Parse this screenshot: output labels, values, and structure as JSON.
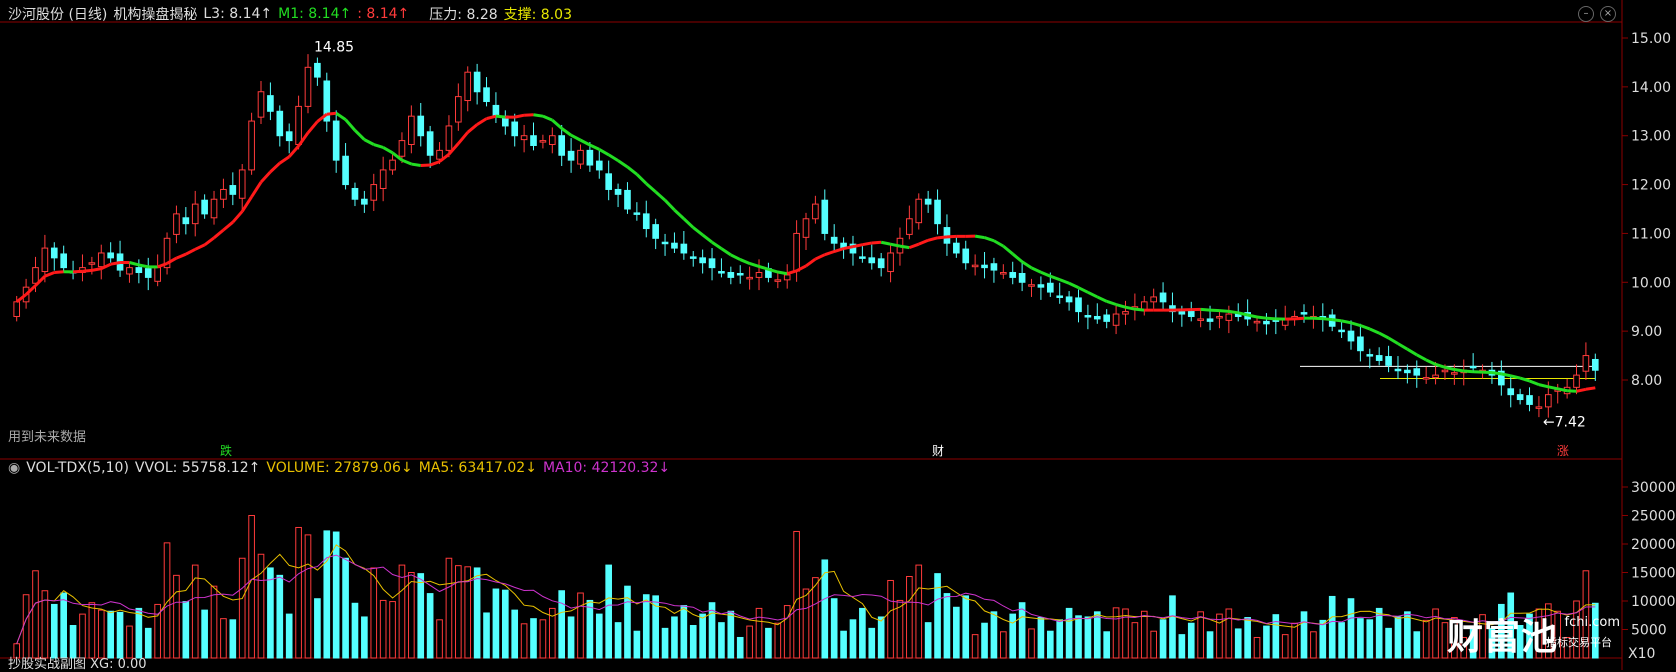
{
  "header": {
    "stock": "沙河股份 (日线)",
    "indicator": "机构操盘揭秘",
    "l3": "L3: 8.14↑",
    "m1": "M1: 8.14↑",
    "m2": ": 8.14↑",
    "pressure": "压力: 8.28",
    "support": "支撑: 8.03"
  },
  "vol_header": {
    "name": "VOL-TDX(5,10)",
    "vvol": "VVOL: 55758.12↑",
    "volume": "VOLUME: 27879.06↓",
    "ma5": "MA5: 63417.02↓",
    "ma10": "MA10: 42120.32↓"
  },
  "bottom_label": "抄股实战副图 XG: 0.00",
  "notes": {
    "future_data": "用到未来数据",
    "high_label": "14.85",
    "low_label": "←7.42",
    "die": "跌",
    "cai": "财",
    "zhang": "涨"
  },
  "watermark": {
    "logo": "财富池",
    "site": "fchi.com",
    "tag": "指标交易平台"
  },
  "colors": {
    "up": "#ff3b3b",
    "down": "#55ffff",
    "ma_red": "#ff1a1a",
    "ma_green": "#22dd22",
    "ma5": "#e8c000",
    "ma10": "#cc33cc",
    "support_line": "#e8e800",
    "pressure_line": "#ffffff",
    "grid": "#8b0000"
  },
  "chart_data": {
    "type": "candlestick",
    "price_axis": {
      "ticks": [
        8.0,
        9.0,
        10.0,
        11.0,
        12.0,
        13.0,
        14.0,
        15.0
      ],
      "ylim": [
        7.2,
        15.3
      ]
    },
    "volume_axis": {
      "ticks": [
        5000,
        10000,
        15000,
        20000,
        25000,
        30000
      ],
      "ylim": [
        0,
        32000
      ],
      "unit": "X10"
    },
    "close": [
      9.6,
      9.9,
      10.3,
      10.7,
      10.5,
      10.3,
      10.2,
      10.3,
      10.4,
      10.6,
      10.5,
      10.25,
      10.3,
      10.2,
      10.1,
      10.3,
      10.9,
      11.4,
      11.2,
      11.6,
      11.4,
      11.7,
      11.9,
      11.8,
      12.3,
      13.3,
      13.9,
      13.5,
      13.0,
      12.9,
      13.6,
      14.4,
      14.2,
      13.3,
      12.5,
      12.0,
      11.7,
      11.6,
      12.0,
      12.3,
      12.5,
      12.9,
      13.4,
      13.0,
      12.6,
      12.7,
      13.2,
      13.8,
      14.3,
      13.9,
      13.7,
      13.4,
      13.2,
      13.0,
      13.0,
      12.8,
      12.9,
      13.0,
      12.6,
      12.5,
      12.7,
      12.4,
      12.3,
      11.9,
      11.8,
      11.5,
      11.4,
      11.1,
      10.9,
      10.8,
      10.7,
      10.6,
      10.5,
      10.4,
      10.3,
      10.2,
      10.1,
      10.15,
      10.1,
      10.2,
      10.1,
      10.05,
      10.15,
      11.0,
      11.3,
      11.6,
      11.0,
      10.8,
      10.7,
      10.6,
      10.5,
      10.4,
      10.3,
      10.6,
      10.9,
      11.3,
      11.7,
      11.6,
      11.2,
      10.8,
      10.6,
      10.4,
      10.35,
      10.3,
      10.25,
      10.2,
      10.1,
      10.0,
      9.95,
      9.9,
      9.8,
      9.7,
      9.6,
      9.4,
      9.3,
      9.25,
      9.2,
      9.35,
      9.4,
      9.5,
      9.6,
      9.7,
      9.6,
      9.4,
      9.35,
      9.3,
      9.25,
      9.2,
      9.3,
      9.35,
      9.3,
      9.25,
      9.2,
      9.15,
      9.2,
      9.25,
      9.3,
      9.35,
      9.3,
      9.25,
      9.1,
      9.0,
      8.8,
      8.6,
      8.5,
      8.4,
      8.3,
      8.2,
      8.15,
      8.1,
      8.05,
      8.1,
      8.2,
      8.15,
      8.2,
      8.25,
      8.2,
      8.1,
      7.9,
      7.7,
      7.6,
      7.5,
      7.45,
      7.7,
      7.8,
      7.85,
      8.1,
      8.5,
      8.2
    ],
    "annotations": {
      "high": 14.85,
      "low": 7.42,
      "pressure": 8.28,
      "support": 8.03
    }
  }
}
